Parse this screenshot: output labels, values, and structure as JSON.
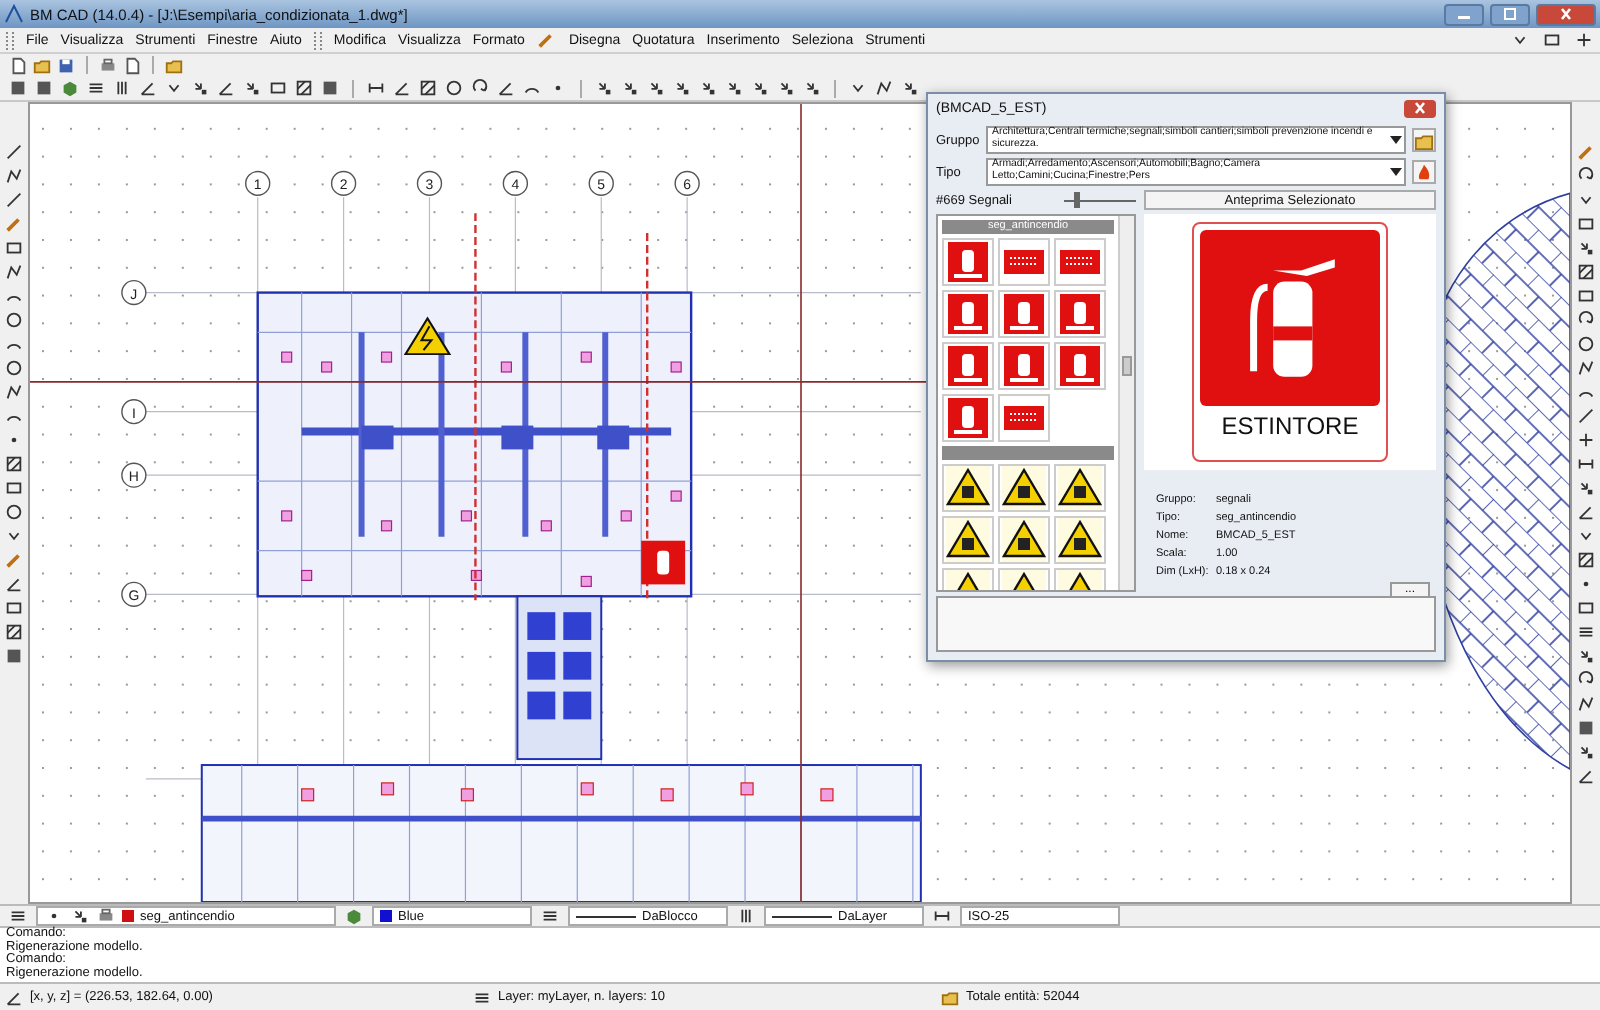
{
  "window": {
    "title": "BM CAD (14.0.4) - [J:\\Esempi\\aria_condizionata_1.dwg*]"
  },
  "menu": [
    {
      "label": "File"
    },
    {
      "label": "Visualizza"
    },
    {
      "label": "Strumenti"
    },
    {
      "label": "Finestre"
    },
    {
      "label": "Aiuto"
    },
    {
      "label": "Modifica",
      "grip": true
    },
    {
      "label": "Visualizza"
    },
    {
      "label": "Formato"
    },
    {
      "label": "Disegna",
      "icon": true
    },
    {
      "label": "Quotatura"
    },
    {
      "label": "Inserimento"
    },
    {
      "label": "Seleziona"
    },
    {
      "label": "Strumenti"
    }
  ],
  "drawing": {
    "column_labels": [
      "1",
      "2",
      "3",
      "4",
      "5",
      "6"
    ],
    "row_labels": [
      "J",
      "I",
      "H",
      "G"
    ]
  },
  "dialog": {
    "title": "(BMCAD_5_EST)",
    "fields": [
      {
        "label": "Gruppo",
        "value": "Architettura;Centrali termiche;segnali;simboli cantieri;simboli prevenzione incendi e sicurezza."
      },
      {
        "label": "Tipo",
        "value": "Armadi;Arredamento;Ascensori;Automobili;Bagno;Camera Letto;Camini;Cucina;Finestre;Pers"
      }
    ],
    "count": "#669 Segnali",
    "zoom": {
      "level": 0.15
    },
    "categories": [
      {
        "label": "seg_antincendio",
        "items": [
          {
            "kind": "fire"
          },
          {
            "kind": "fire-text"
          },
          {
            "kind": "fire-text"
          },
          {
            "kind": "fire"
          },
          {
            "kind": "fire"
          },
          {
            "kind": "fire"
          },
          {
            "kind": "fire"
          },
          {
            "kind": "fire"
          },
          {
            "kind": "fire"
          },
          {
            "kind": "fire"
          },
          {
            "kind": "fire-text"
          }
        ]
      },
      {
        "items": [
          {
            "kind": "warning"
          },
          {
            "kind": "warning"
          },
          {
            "kind": "warning"
          },
          {
            "kind": "warning"
          },
          {
            "kind": "warning"
          },
          {
            "kind": "warning"
          },
          {
            "kind": "warning"
          },
          {
            "kind": "warning"
          },
          {
            "kind": "warning"
          }
        ]
      }
    ],
    "preview_title": "Anteprima Selezionato",
    "preview_caption": "ESTINTORE",
    "info": [
      {
        "label": "Gruppo:",
        "value": "segnali"
      },
      {
        "label": "Tipo:",
        "value": "seg_antincendio"
      },
      {
        "label": "Nome:",
        "value": "BMCAD_5_EST"
      },
      {
        "label": "Scala:",
        "value": "1.00"
      },
      {
        "label": "Dim (LxH):",
        "value": "0.18 x 0.24"
      }
    ],
    "more_button": "..."
  },
  "properties": {
    "layer": {
      "name": "seg_antincendio",
      "color": "#d01010"
    },
    "color": {
      "name": "Blue",
      "color": "#1010d0"
    },
    "linetype": "DaBlocco",
    "lineweight": "DaLayer",
    "dimstyle": "ISO-25"
  },
  "command_lines": [
    "Comando:",
    "Rigenerazione modello.",
    "Comando:",
    "Rigenerazione modello."
  ],
  "status_bar": [
    "[x, y, z] = (226.53, 182.64, 0.00)",
    "Layer: myLayer, n. layers: 10",
    "Totale entità: 52044"
  ]
}
